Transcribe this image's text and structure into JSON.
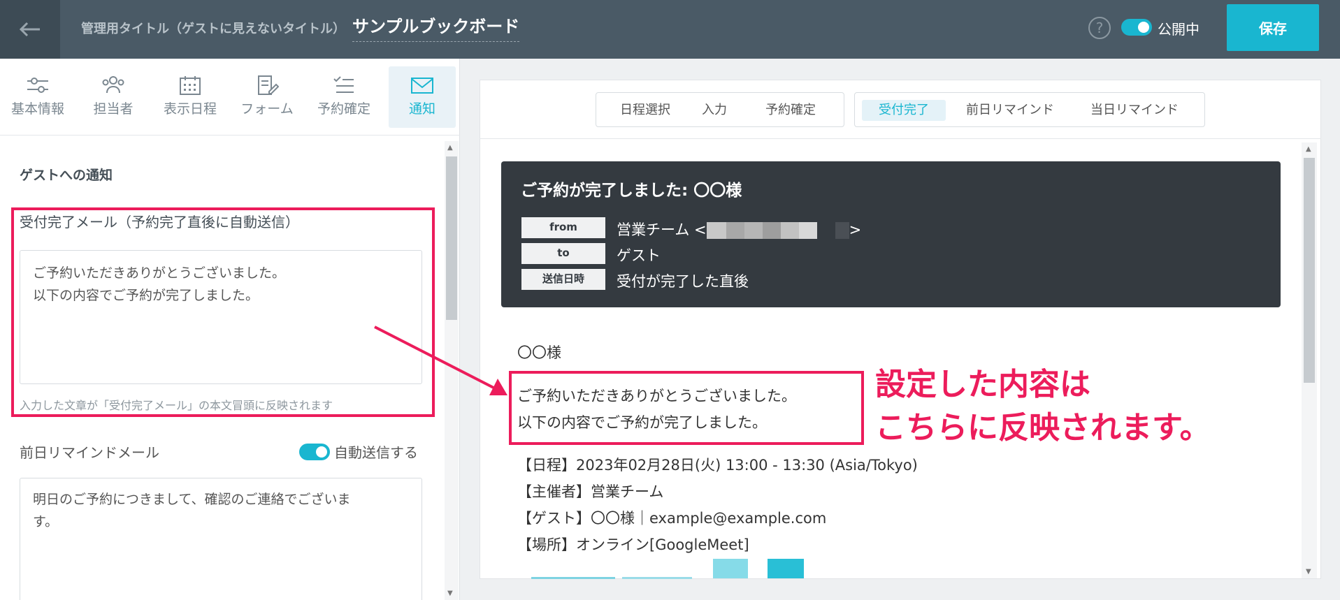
{
  "header": {
    "back_icon": "arrow-left-icon",
    "admin_title_label": "管理用タイトル（ゲストに見えないタイトル）",
    "title": "サンプルブックボード",
    "help_icon": "question-circle-icon",
    "help_glyph": "?",
    "publish_label": "公開中",
    "save_label": "保存"
  },
  "tabs": [
    {
      "label": "基本情報",
      "icon": "sliders-icon"
    },
    {
      "label": "担当者",
      "icon": "users-icon"
    },
    {
      "label": "表示日程",
      "icon": "calendar-icon"
    },
    {
      "label": "フォーム",
      "icon": "form-edit-icon"
    },
    {
      "label": "予約確定",
      "icon": "checklist-icon"
    },
    {
      "label": "通知",
      "icon": "envelope-icon",
      "active": true
    }
  ],
  "left": {
    "section_title": "ゲストへの通知",
    "accept_mail_label": "受付完了メール（予約完了直後に自動送信）",
    "accept_mail_line1": "ご予約いただきありがとうございました。",
    "accept_mail_line2": "以下の内容でご予約が完了しました。",
    "accept_mail_hint": "入力した文章が「受付完了メール」の本文冒頭に反映されます",
    "remind_label": "前日リマインドメール",
    "auto_send_label": "自動送信する",
    "remind_line1": "明日のご予約につきまして、確認のご連絡でございま",
    "remind_line2": "す。"
  },
  "preview": {
    "seg1": [
      "日程選択",
      "入力",
      "予約確定"
    ],
    "seg2": [
      "受付完了",
      "前日リマインド",
      "当日リマインド"
    ],
    "mail_subject": "ご予約が完了しました: 〇〇様",
    "meta": [
      {
        "key": "from",
        "value": "営業チーム <"
      },
      {
        "key": "to",
        "value": "ゲスト"
      },
      {
        "key": "送信日時",
        "value": "受付が完了した直後"
      }
    ],
    "from_close": ">",
    "greeting": "〇〇様",
    "body_line1": "ご予約いただきありがとうございました。",
    "body_line2": "以下の内容でご予約が完了しました。",
    "detail_date": "【日程】2023年02月28日(火) 13:00 - 13:30 (Asia/Tokyo)",
    "detail_host": "【主催者】営業チーム",
    "detail_guest": "【ゲスト】〇〇様｜example@example.com",
    "detail_place": "【場所】オンライン[GoogleMeet]"
  },
  "annotation": {
    "line1": "設定した内容は",
    "line2": "こちらに反映されます。"
  },
  "colors": {
    "accent": "#19b6d0",
    "highlight": "#ec1c5b",
    "header_bg": "#4a5a66",
    "mail_card_bg": "#343a40"
  }
}
